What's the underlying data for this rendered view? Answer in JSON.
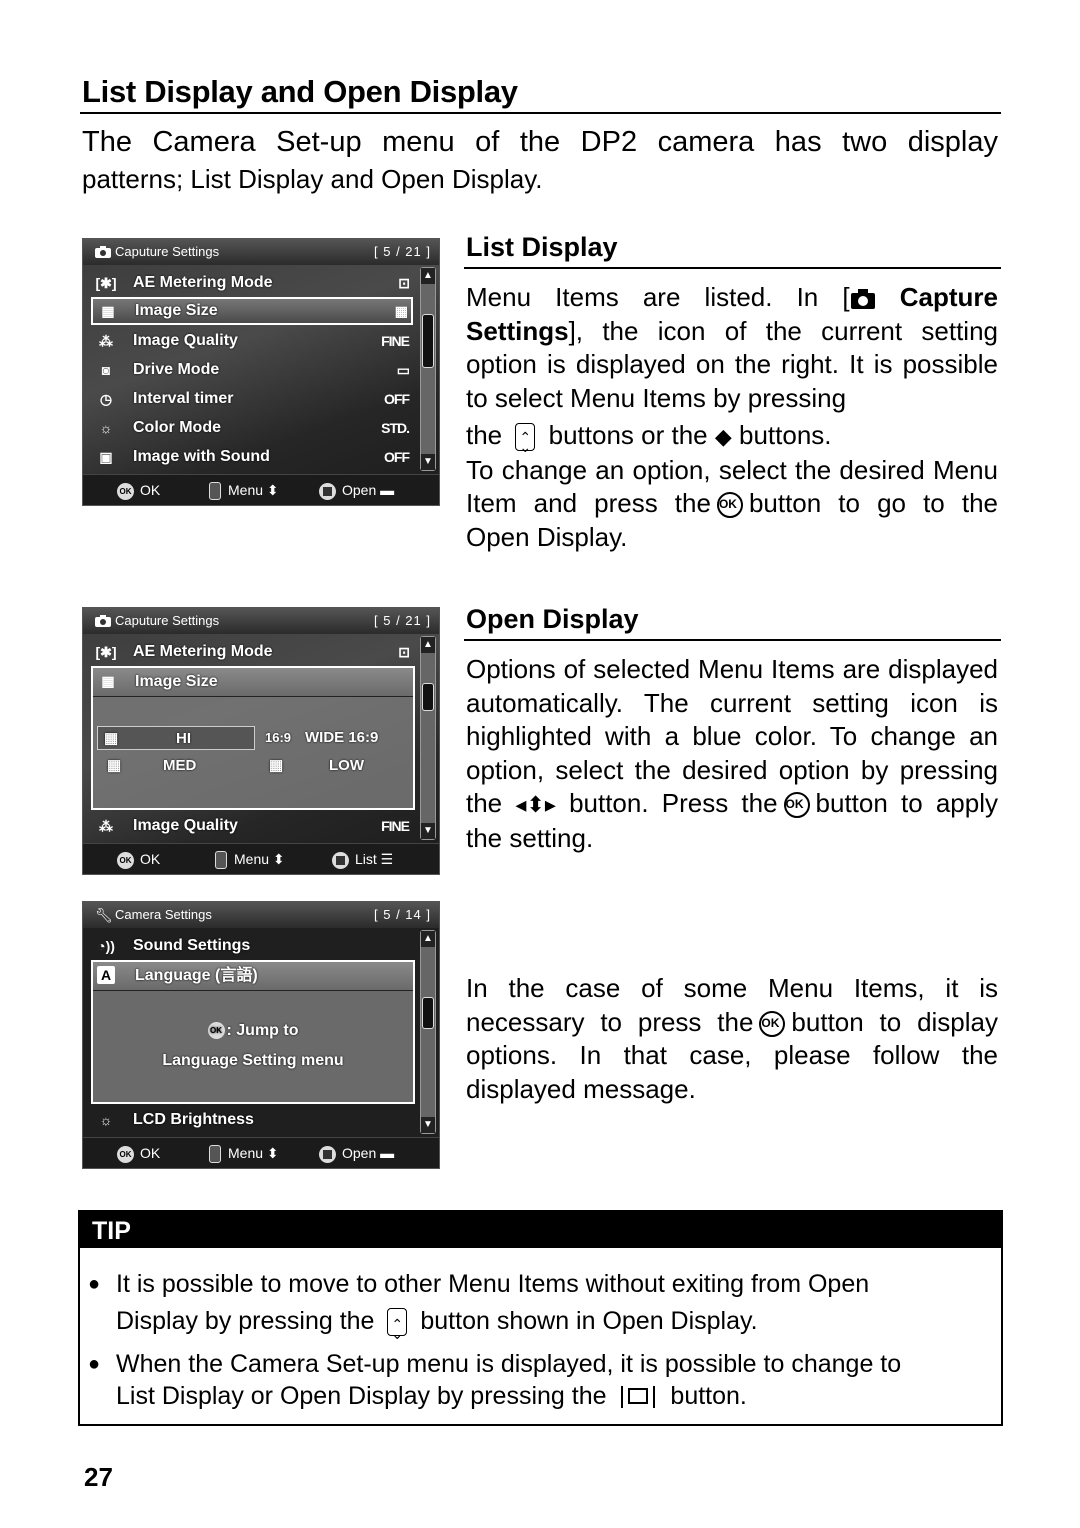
{
  "page": {
    "title": "List Display and Open Display",
    "intro_line1": "The Camera Set-up menu of the DP2 camera has two display",
    "intro_line2": "patterns; List Display and Open Display.",
    "page_number": "27"
  },
  "list_display": {
    "heading": "List Display",
    "text_a": "Menu Items are listed. In [",
    "text_bold": "Capture Settings",
    "text_b": "], the icon of the current setting option is displayed on the right. It is possible to select Menu Items by pressing",
    "text_c1": "the",
    "text_c2": "buttons or the",
    "text_c3": "buttons.",
    "text_d1": "To change an option, select the desired Menu Item and press the",
    "text_d2": "button to go to the Open Display."
  },
  "open_display": {
    "heading": "Open Display",
    "text_a": "Options of selected Menu Items are displayed automatically. The current setting icon is highlighted with a blue color. To change an option, select the desired option by pressing the",
    "text_b1": "button. Press the",
    "text_b2": "button to apply the setting."
  },
  "note": {
    "text_a": "In the case of some Menu Items, it is necessary to press the",
    "text_b": "button to display options. In that case, please follow the displayed message."
  },
  "icons": {
    "ok_glyph": "OK",
    "updown_glyph": "◆"
  },
  "screen1": {
    "title": "Caputure Settings",
    "page": "[ 5 / 21 ]",
    "items": [
      {
        "icon": "[✱]",
        "label": "AE Metering Mode",
        "value": "⊡"
      },
      {
        "icon": "▦",
        "label": "Image Size",
        "value": "▦"
      },
      {
        "icon": "⁂",
        "label": "Image Quality",
        "value": "FINE"
      },
      {
        "icon": "◙",
        "label": "Drive Mode",
        "value": "▭"
      },
      {
        "icon": "◷",
        "label": "Interval timer",
        "value": "OFF"
      },
      {
        "icon": "☼",
        "label": "Color Mode",
        "value": "STD."
      },
      {
        "icon": "▣",
        "label": "Image with Sound",
        "value": "OFF"
      }
    ],
    "footer": {
      "ok": "OK",
      "menu": "Menu ⬍",
      "open": "Open ▬"
    }
  },
  "screen2": {
    "title": "Caputure Settings",
    "page": "[ 5 / 21 ]",
    "top_item": {
      "icon": "[✱]",
      "label": "AE Metering Mode",
      "value": "⊡"
    },
    "panel_title": {
      "icon": "▦",
      "label": "Image Size"
    },
    "options": [
      {
        "icon": "▦",
        "label": "HI",
        "selected": true
      },
      {
        "icon": "16:9",
        "label": "WIDE 16:9",
        "selected": false
      },
      {
        "icon": "▦",
        "label": "MED",
        "selected": false
      },
      {
        "icon": "▦",
        "label": "LOW",
        "selected": false
      }
    ],
    "bottom_item": {
      "icon": "⁂",
      "label": "Image Quality",
      "value": "FINE"
    },
    "footer": {
      "ok": "OK",
      "menu": "Menu ⬍",
      "list": "List ☰"
    }
  },
  "screen3": {
    "title": "Camera Settings",
    "page": "[ 5 / 14 ]",
    "top_item": {
      "icon": "◔))",
      "label": "Sound Settings"
    },
    "panel_title": {
      "icon": "A",
      "label": "Language (言語)"
    },
    "message_line1": ": Jump to",
    "message_line2": "Language Setting menu",
    "bottom_item": {
      "icon": "☼",
      "label": "LCD Brightness"
    },
    "footer": {
      "ok": "OK",
      "menu": "Menu ⬍",
      "open": "Open ▬"
    }
  },
  "tip": {
    "heading": "TIP",
    "item1_a": "It is possible to move to other Menu Items without exiting from Open",
    "item1_b": "Display by pressing the",
    "item1_c": "button shown in Open Display.",
    "item2_a": "When the Camera Set-up menu is displayed, it is possible to change to",
    "item2_b": "List Display or Open Display by pressing the",
    "item2_c": "button."
  }
}
